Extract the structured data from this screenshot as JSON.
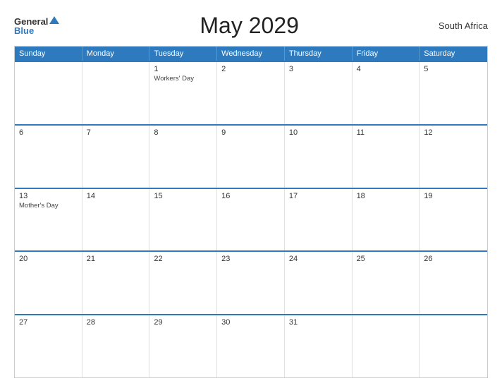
{
  "header": {
    "logo_general": "General",
    "logo_blue": "Blue",
    "title": "May 2029",
    "country": "South Africa"
  },
  "calendar": {
    "day_headers": [
      "Sunday",
      "Monday",
      "Tuesday",
      "Wednesday",
      "Thursday",
      "Friday",
      "Saturday"
    ],
    "weeks": [
      [
        {
          "day": "",
          "event": ""
        },
        {
          "day": "",
          "event": ""
        },
        {
          "day": "1",
          "event": "Workers' Day"
        },
        {
          "day": "2",
          "event": ""
        },
        {
          "day": "3",
          "event": ""
        },
        {
          "day": "4",
          "event": ""
        },
        {
          "day": "5",
          "event": ""
        }
      ],
      [
        {
          "day": "6",
          "event": ""
        },
        {
          "day": "7",
          "event": ""
        },
        {
          "day": "8",
          "event": ""
        },
        {
          "day": "9",
          "event": ""
        },
        {
          "day": "10",
          "event": ""
        },
        {
          "day": "11",
          "event": ""
        },
        {
          "day": "12",
          "event": ""
        }
      ],
      [
        {
          "day": "13",
          "event": "Mother's Day"
        },
        {
          "day": "14",
          "event": ""
        },
        {
          "day": "15",
          "event": ""
        },
        {
          "day": "16",
          "event": ""
        },
        {
          "day": "17",
          "event": ""
        },
        {
          "day": "18",
          "event": ""
        },
        {
          "day": "19",
          "event": ""
        }
      ],
      [
        {
          "day": "20",
          "event": ""
        },
        {
          "day": "21",
          "event": ""
        },
        {
          "day": "22",
          "event": ""
        },
        {
          "day": "23",
          "event": ""
        },
        {
          "day": "24",
          "event": ""
        },
        {
          "day": "25",
          "event": ""
        },
        {
          "day": "26",
          "event": ""
        }
      ],
      [
        {
          "day": "27",
          "event": ""
        },
        {
          "day": "28",
          "event": ""
        },
        {
          "day": "29",
          "event": ""
        },
        {
          "day": "30",
          "event": ""
        },
        {
          "day": "31",
          "event": ""
        },
        {
          "day": "",
          "event": ""
        },
        {
          "day": "",
          "event": ""
        }
      ]
    ]
  }
}
